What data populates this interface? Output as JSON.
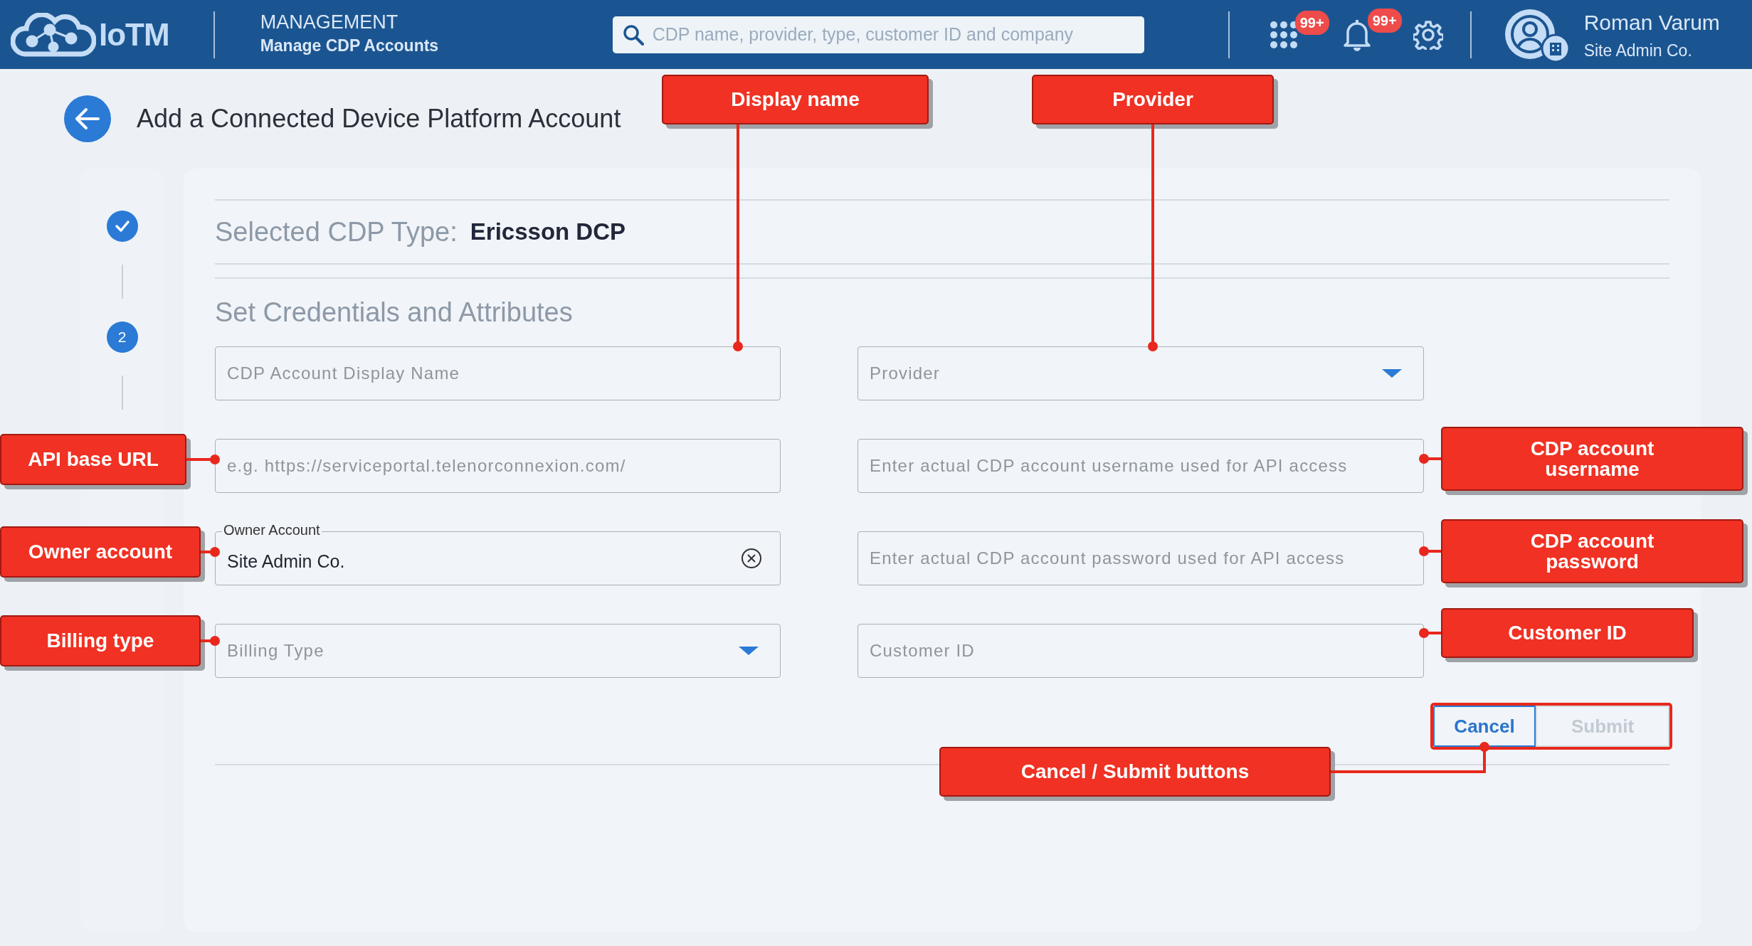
{
  "header": {
    "brand": "IoTM",
    "section": "MANAGEMENT",
    "subtitle": "Manage CDP Accounts",
    "search": {
      "placeholder": "CDP name, provider, type, customer ID and company"
    },
    "apps_badge": "99+",
    "notifications_badge": "99+",
    "user": {
      "name": "Roman Varum",
      "company": "Site Admin Co."
    }
  },
  "page": {
    "title": "Add a Connected Device Platform Account"
  },
  "stepper": [
    {
      "completed": true
    },
    {
      "completed": false,
      "label": "2"
    }
  ],
  "form": {
    "selected_type_label": "Selected CDP Type:",
    "selected_type": "Ericsson DCP",
    "section_title": "Set Credentials and Attributes",
    "fields": [
      {
        "kind": "text",
        "placeholder": "CDP Account Display Name"
      },
      {
        "kind": "select",
        "placeholder": "Provider"
      },
      {
        "kind": "text",
        "placeholder": "e.g. https://serviceportal.telenorconnexion.com/"
      },
      {
        "kind": "text",
        "placeholder": "Enter actual CDP account username used for API access"
      },
      {
        "kind": "combo",
        "label": "Owner Account",
        "value": "Site Admin Co."
      },
      {
        "kind": "text",
        "placeholder": "Enter actual CDP account password used for API access"
      },
      {
        "kind": "select",
        "placeholder": "Billing Type"
      },
      {
        "kind": "text",
        "placeholder": "Customer ID"
      }
    ],
    "buttons": [
      {
        "label": "Cancel",
        "disabled": false
      },
      {
        "label": "Submit",
        "disabled": true
      }
    ]
  },
  "callouts": [
    {
      "text": "Display name",
      "kind": "field"
    },
    {
      "text": "Provider",
      "kind": "field"
    },
    {
      "text": "API base URL",
      "kind": "field"
    },
    {
      "text": "Owner account",
      "kind": "field"
    },
    {
      "text": "Billing type",
      "kind": "field"
    },
    {
      "text": "CDP account username",
      "kind": "field"
    },
    {
      "text": "CDP account password",
      "kind": "field"
    },
    {
      "text": "Customer ID",
      "kind": "field"
    },
    {
      "text": "Cancel / Submit buttons",
      "kind": "buttons"
    }
  ]
}
